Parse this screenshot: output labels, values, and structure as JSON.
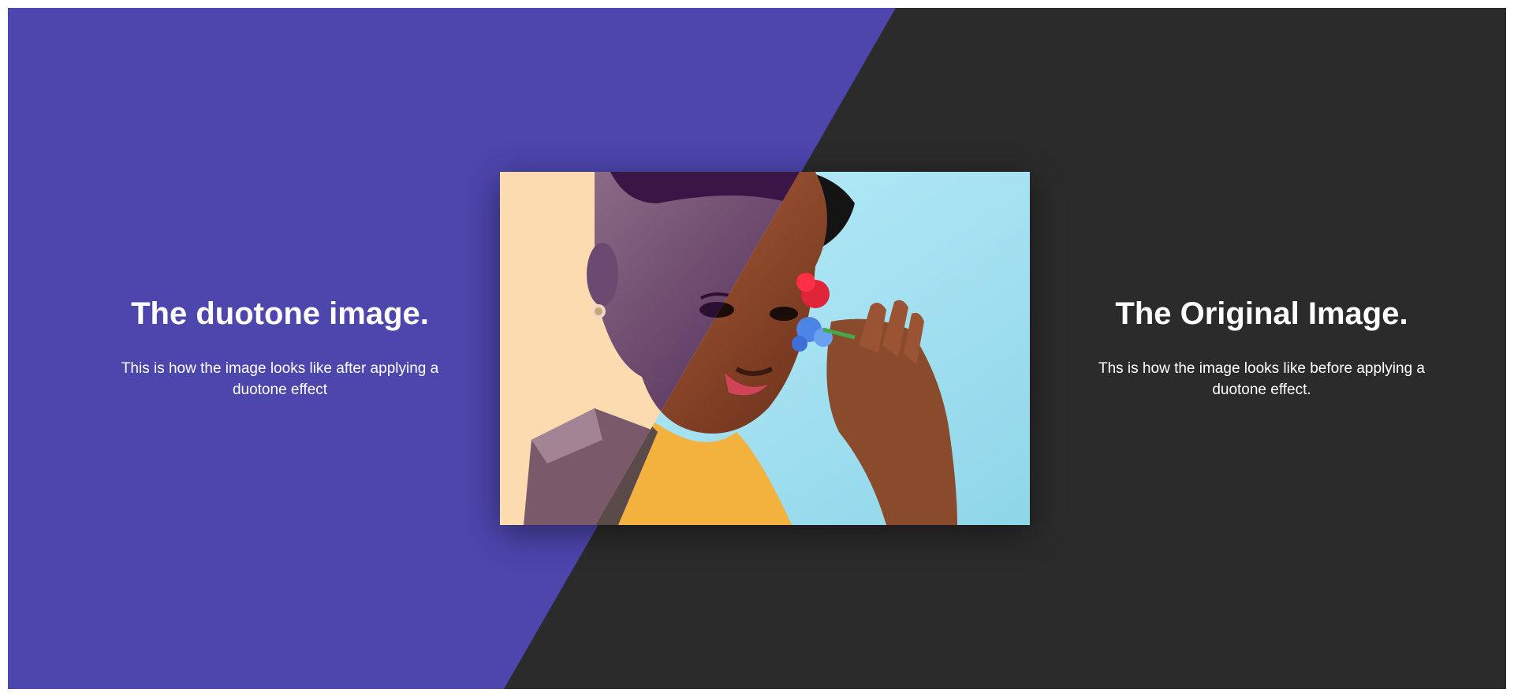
{
  "colors": {
    "duotone_bg": "#4c46ad",
    "original_bg": "#2b2b2b",
    "text": "#ffffff"
  },
  "left": {
    "title": "The duotone image.",
    "description": "This is how the image looks like after applying a duotone effect"
  },
  "right": {
    "title": "The Original Image.",
    "description": "Ths is how the image looks like before applying a duotone effect."
  },
  "image": {
    "subject": "portrait-with-flowers",
    "left_half": "duotone",
    "right_half": "original"
  }
}
